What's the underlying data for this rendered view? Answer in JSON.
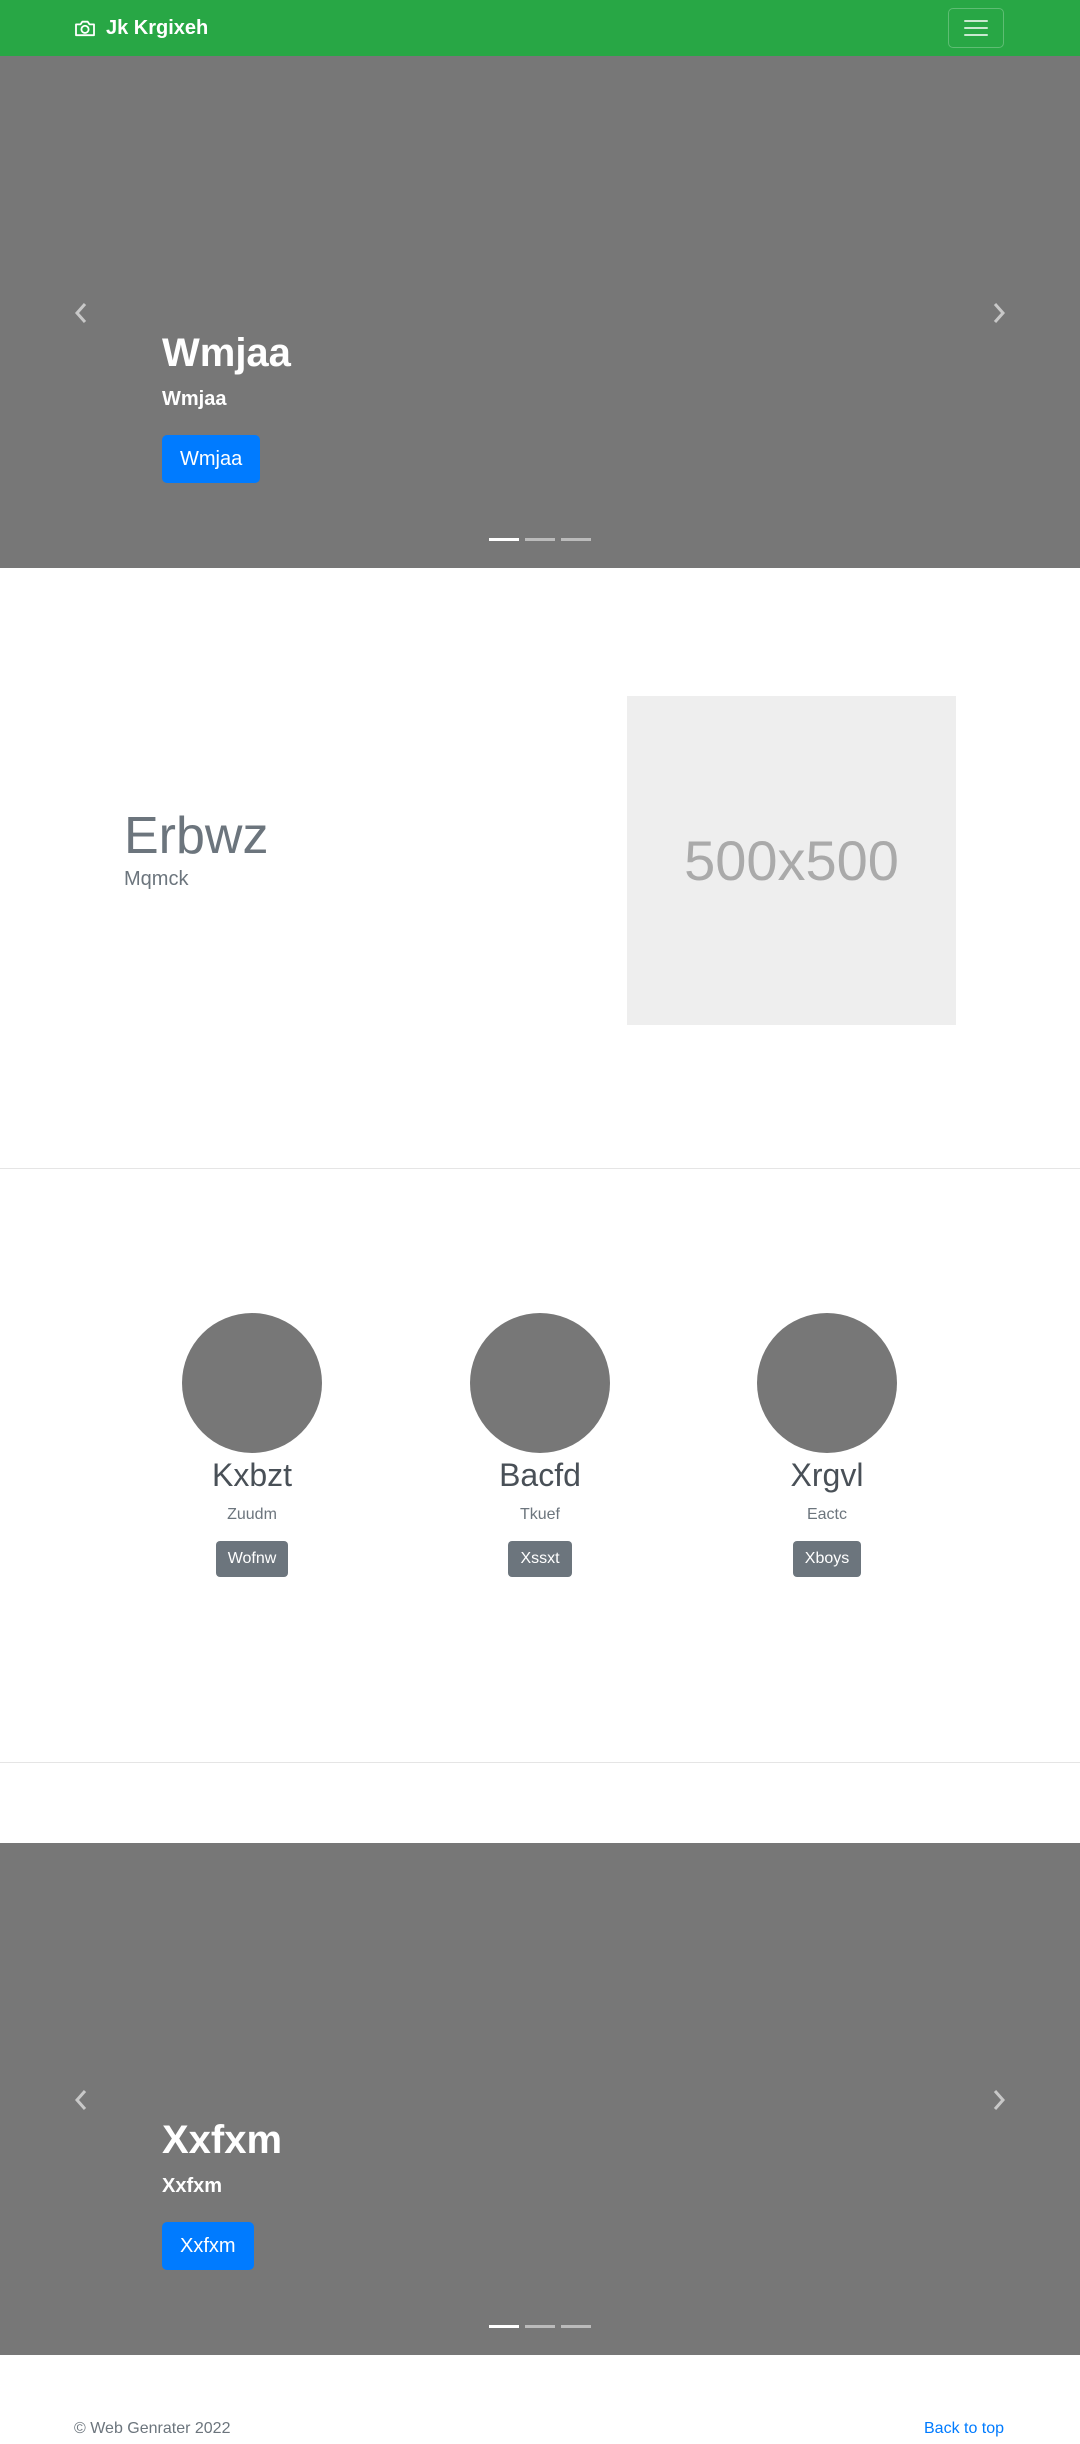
{
  "navbar": {
    "brand": "Jk Krgixeh",
    "brand_icon": "camera-icon",
    "toggler_icon": "hamburger-menu-icon",
    "background": "#28a745"
  },
  "carousel_top": {
    "title": "Wmjaa",
    "subtitle": "Wmjaa",
    "button": "Wmjaa",
    "slide_count": 3,
    "active_slide": 1
  },
  "featurette": {
    "title": "Erbwz",
    "subtitle": "Mqmck",
    "image_placeholder": "500x500"
  },
  "columns": [
    {
      "name": "Kxbzt",
      "desc": "Zuudm",
      "button": "Wofnw"
    },
    {
      "name": "Bacfd",
      "desc": "Tkuef",
      "button": "Xssxt"
    },
    {
      "name": "Xrgvl",
      "desc": "Eactc",
      "button": "Xboys"
    }
  ],
  "carousel_bottom": {
    "title": "Xxfxm",
    "subtitle": "Xxfxm",
    "button": "Xxfxm",
    "slide_count": 3,
    "active_slide": 1
  },
  "footer": {
    "copyright": "© Web Genrater 2022",
    "back_to_top": "Back to top"
  },
  "colors": {
    "primary": "#007bff",
    "secondary": "#6c757d",
    "carousel_bg": "#777777"
  }
}
